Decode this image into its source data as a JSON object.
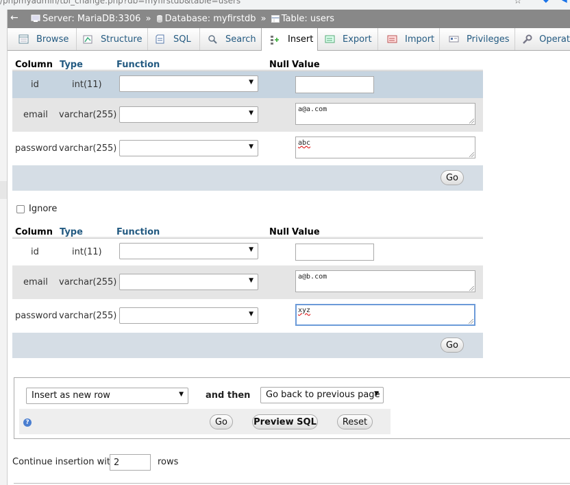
{
  "browser": {
    "url": "/phpmyadmin/tbl_change.php?db=myfirstdb&table=users"
  },
  "breadcrumb": {
    "back": "←",
    "server": "Server: MariaDB:3306",
    "sep1": "»",
    "database": "Database: myfirstdb",
    "sep2": "»",
    "table": "Table: users"
  },
  "tabs": [
    {
      "label": "Browse",
      "icon": "browse-icon"
    },
    {
      "label": "Structure",
      "icon": "structure-icon"
    },
    {
      "label": "SQL",
      "icon": "sql-icon"
    },
    {
      "label": "Search",
      "icon": "search-icon"
    },
    {
      "label": "Insert",
      "icon": "insert-icon",
      "active": true
    },
    {
      "label": "Export",
      "icon": "export-icon"
    },
    {
      "label": "Import",
      "icon": "import-icon"
    },
    {
      "label": "Privileges",
      "icon": "privileges-icon"
    },
    {
      "label": "Operat",
      "icon": "operations-icon"
    }
  ],
  "columns_header": {
    "column": "Column",
    "type": "Type",
    "function": "Function",
    "null": "Null",
    "value": "Value"
  },
  "form1": {
    "rows": [
      {
        "name": "id",
        "type": "int(11)",
        "function": "",
        "value": ""
      },
      {
        "name": "email",
        "type": "varchar(255)",
        "function": "",
        "value": "a@a.com"
      },
      {
        "name": "password",
        "type": "varchar(255)",
        "function": "",
        "value": "abc"
      }
    ],
    "go_label": "Go"
  },
  "ignore": {
    "label": "Ignore",
    "checked": false
  },
  "form2": {
    "rows": [
      {
        "name": "id",
        "type": "int(11)",
        "function": "",
        "value": ""
      },
      {
        "name": "email",
        "type": "varchar(255)",
        "function": "",
        "value": "a@b.com"
      },
      {
        "name": "password",
        "type": "varchar(255)",
        "function": "",
        "value": "xyz"
      }
    ],
    "go_label": "Go"
  },
  "actions": {
    "insert_mode": "Insert as new row",
    "and_then": "and then",
    "after": "Go back to previous page",
    "go_label": "Go",
    "preview_label": "Preview SQL",
    "reset_label": "Reset",
    "help_icon": "help-icon"
  },
  "continue": {
    "prefix": "Continue insertion with",
    "value": "2",
    "suffix": "rows"
  },
  "colors": {
    "breadcrumb_bg": "#888888",
    "row_highlight": "#c6d4e0",
    "row_alt": "#e5e5e5",
    "gobar": "#d5dde5",
    "link": "#235a81"
  }
}
